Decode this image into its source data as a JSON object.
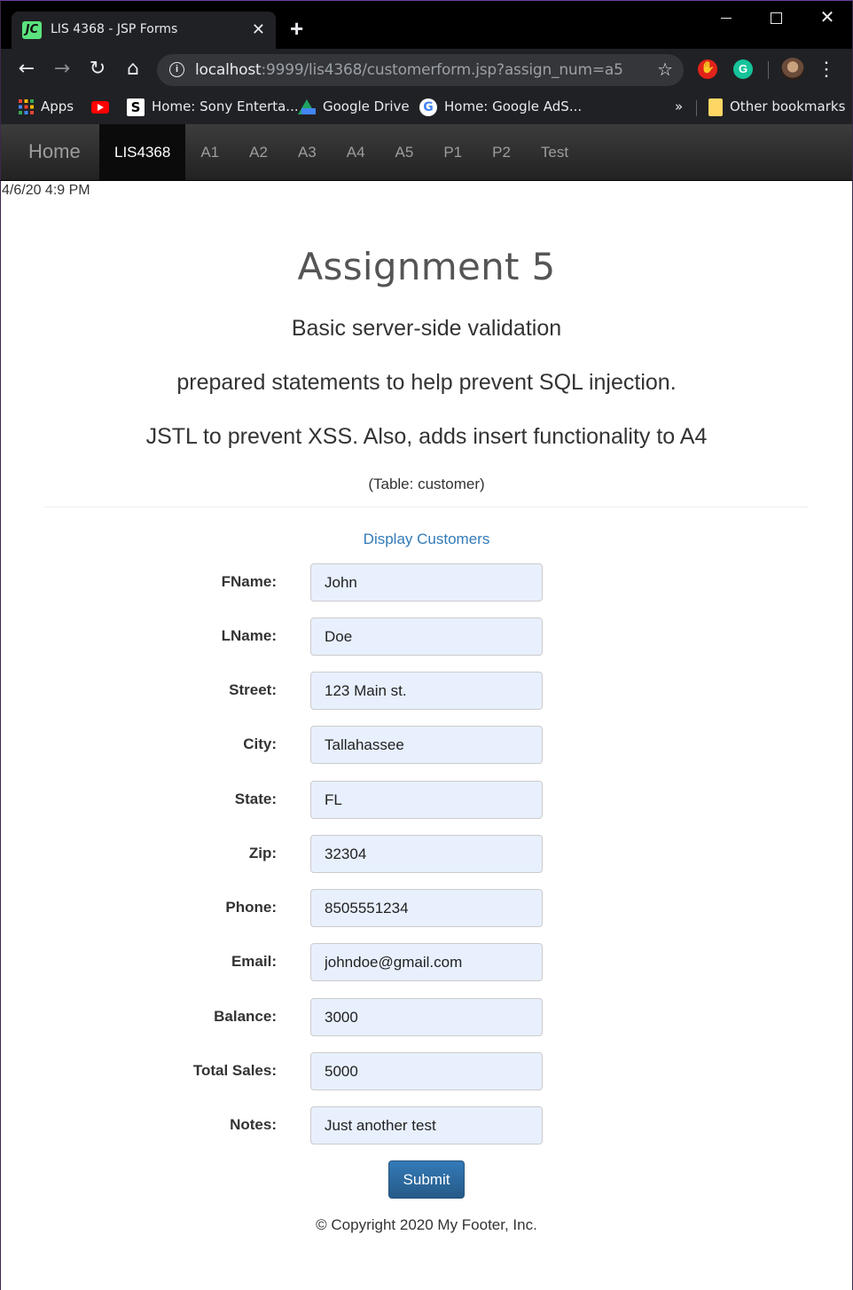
{
  "browser": {
    "tab_title": "LIS 4368 - JSP Forms",
    "tab_favicon_text": "JC",
    "url_host": "localhost",
    "url_rest": ":9999/lis4368/customerform.jsp?assign_num=a5",
    "bookmarks": [
      {
        "label": "Apps",
        "icon": "apps-grid-icon"
      },
      {
        "label": "",
        "icon": "youtube-icon"
      },
      {
        "label": "Home: Sony Enterta...",
        "icon": "sony-icon"
      },
      {
        "label": "Google Drive",
        "icon": "google-drive-icon"
      },
      {
        "label": "Home: Google AdS...",
        "icon": "google-icon"
      }
    ],
    "bookmarks_overflow": "»",
    "other_bookmarks": "Other bookmarks"
  },
  "navbar": {
    "brand": "Home",
    "items": [
      {
        "label": "LIS4368",
        "active": true
      },
      {
        "label": "A1"
      },
      {
        "label": "A2"
      },
      {
        "label": "A3"
      },
      {
        "label": "A4"
      },
      {
        "label": "A5"
      },
      {
        "label": "P1"
      },
      {
        "label": "P2"
      },
      {
        "label": "Test"
      }
    ]
  },
  "datetime": "4/6/20 4:9 PM",
  "header": {
    "title": "Assignment 5",
    "line1": "Basic server-side validation",
    "line2": "prepared statements to help prevent SQL injection.",
    "line3": "JSTL to prevent XSS. Also, adds insert functionality to A4",
    "table_info": "(Table: customer)"
  },
  "display_link": "Display Customers",
  "form": {
    "fields": [
      {
        "label": "FName:",
        "value": "John"
      },
      {
        "label": "LName:",
        "value": "Doe"
      },
      {
        "label": "Street:",
        "value": "123 Main st."
      },
      {
        "label": "City:",
        "value": "Tallahassee"
      },
      {
        "label": "State:",
        "value": "FL"
      },
      {
        "label": "Zip:",
        "value": "32304"
      },
      {
        "label": "Phone:",
        "value": "8505551234"
      },
      {
        "label": "Email:",
        "value": "johndoe@gmail.com"
      },
      {
        "label": "Balance:",
        "value": "3000"
      },
      {
        "label": "Total Sales:",
        "value": "5000"
      },
      {
        "label": "Notes:",
        "value": "Just another test"
      }
    ],
    "submit_label": "Submit"
  },
  "footer": "© Copyright 2020 My Footer, Inc.",
  "colors": {
    "accent": "#337ab7",
    "input_bg": "#e8f0fe",
    "navbar_bg": "#222222"
  }
}
